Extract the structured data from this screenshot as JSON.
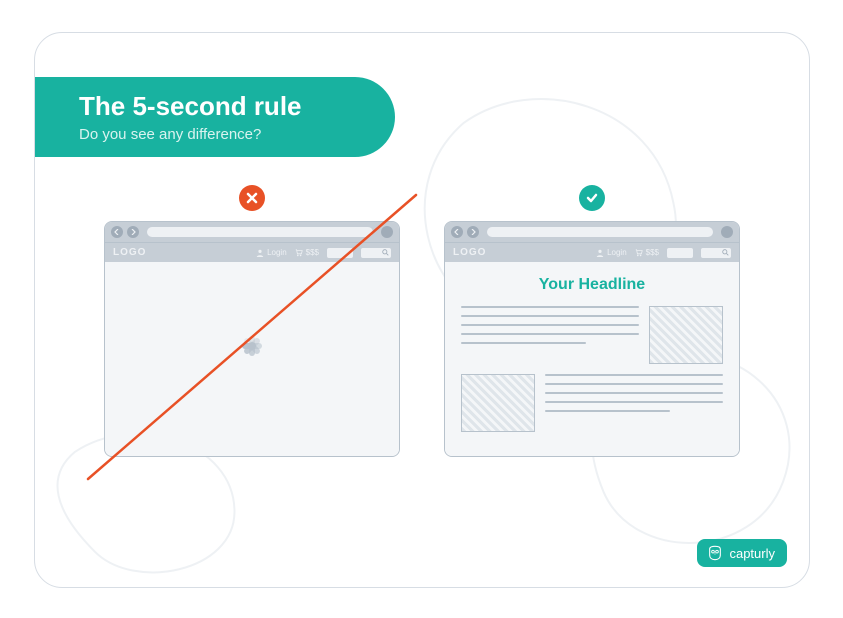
{
  "header": {
    "title": "The 5-second rule",
    "subtitle": "Do you see any difference?"
  },
  "browser": {
    "logo": "LOGO",
    "login": "Login",
    "price": "$$$"
  },
  "right": {
    "headline": "Your Headline"
  },
  "brand": {
    "name": "capturly"
  },
  "icons": {
    "cross": "cross-icon",
    "check": "check-icon"
  }
}
